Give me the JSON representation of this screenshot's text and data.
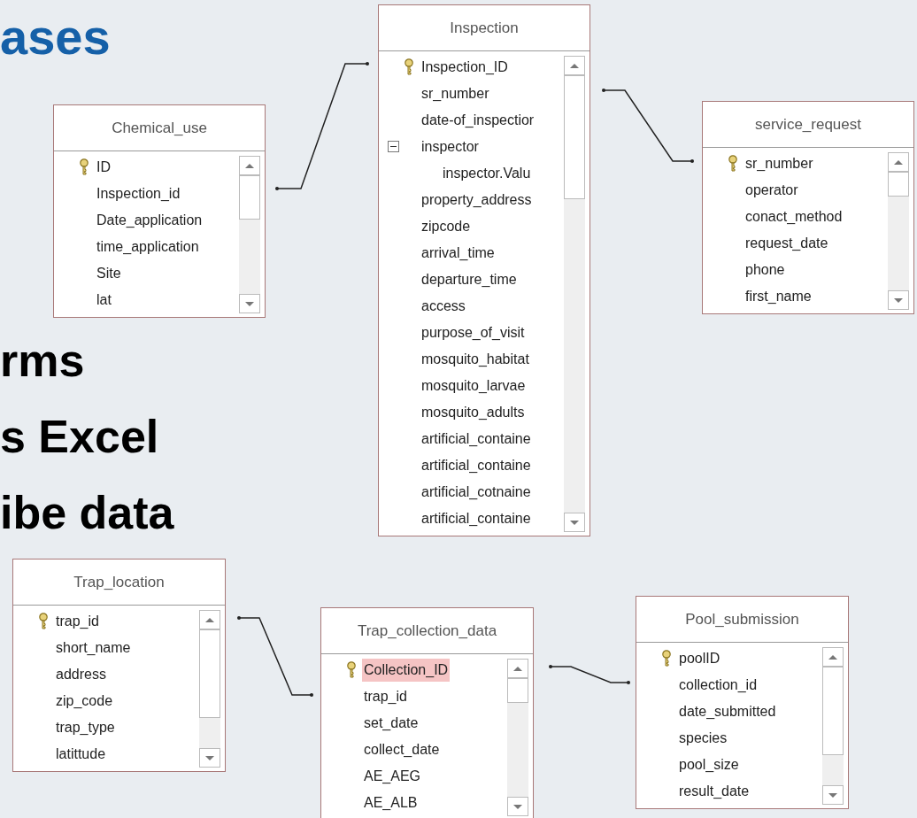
{
  "slide_text": [
    {
      "text": "ases",
      "kind": "heading"
    },
    {
      "text": "rms",
      "kind": "bullet"
    },
    {
      "text": "s Excel",
      "kind": "bullet"
    },
    {
      "text": "ibe data",
      "kind": "bullet"
    }
  ],
  "tables": [
    {
      "title": "Chemical_use",
      "fields": [
        {
          "name": "ID",
          "key": true,
          "selected": false
        },
        {
          "name": "Inspection_id",
          "key": false,
          "selected": false
        },
        {
          "name": "Date_application",
          "key": false,
          "selected": false
        },
        {
          "name": "time_application",
          "key": false,
          "selected": false
        },
        {
          "name": "Site",
          "key": false,
          "selected": false
        },
        {
          "name": "lat",
          "key": false,
          "selected": false
        }
      ]
    },
    {
      "title": "Inspection",
      "fields": [
        {
          "name": "Inspection_ID",
          "key": true,
          "selected": false
        },
        {
          "name": "sr_number",
          "key": false,
          "selected": false
        },
        {
          "name": "date-of_inspectior",
          "key": false,
          "selected": false
        },
        {
          "name": "inspector",
          "key": false,
          "selected": false,
          "expanded": true,
          "children": [
            {
              "name": "inspector.Valu",
              "key": false,
              "selected": false
            }
          ]
        },
        {
          "name": "property_address",
          "key": false,
          "selected": false
        },
        {
          "name": "zipcode",
          "key": false,
          "selected": false
        },
        {
          "name": "arrival_time",
          "key": false,
          "selected": false
        },
        {
          "name": "departure_time",
          "key": false,
          "selected": false
        },
        {
          "name": "access",
          "key": false,
          "selected": false
        },
        {
          "name": "purpose_of_visit",
          "key": false,
          "selected": false
        },
        {
          "name": "mosquito_habitat",
          "key": false,
          "selected": false
        },
        {
          "name": "mosquito_larvae",
          "key": false,
          "selected": false
        },
        {
          "name": "mosquito_adults",
          "key": false,
          "selected": false
        },
        {
          "name": "artificial_containe",
          "key": false,
          "selected": false
        },
        {
          "name": "artificial_containe",
          "key": false,
          "selected": false
        },
        {
          "name": "artificial_cotnaine",
          "key": false,
          "selected": false
        },
        {
          "name": "artificial_containe",
          "key": false,
          "selected": false
        }
      ]
    },
    {
      "title": "service_request",
      "fields": [
        {
          "name": "sr_number",
          "key": true,
          "selected": false
        },
        {
          "name": "operator",
          "key": false,
          "selected": false
        },
        {
          "name": "conact_method",
          "key": false,
          "selected": false
        },
        {
          "name": "request_date",
          "key": false,
          "selected": false
        },
        {
          "name": "phone",
          "key": false,
          "selected": false
        },
        {
          "name": "first_name",
          "key": false,
          "selected": false
        }
      ]
    },
    {
      "title": "Trap_location",
      "fields": [
        {
          "name": "trap_id",
          "key": true,
          "selected": false
        },
        {
          "name": "short_name",
          "key": false,
          "selected": false
        },
        {
          "name": "address",
          "key": false,
          "selected": false
        },
        {
          "name": "zip_code",
          "key": false,
          "selected": false
        },
        {
          "name": "trap_type",
          "key": false,
          "selected": false
        },
        {
          "name": "latittude",
          "key": false,
          "selected": false
        }
      ]
    },
    {
      "title": "Trap_collection_data",
      "fields": [
        {
          "name": "Collection_ID",
          "key": true,
          "selected": true
        },
        {
          "name": "trap_id",
          "key": false,
          "selected": false
        },
        {
          "name": "set_date",
          "key": false,
          "selected": false
        },
        {
          "name": "collect_date",
          "key": false,
          "selected": false
        },
        {
          "name": "AE_AEG",
          "key": false,
          "selected": false
        },
        {
          "name": "AE_ALB",
          "key": false,
          "selected": false
        }
      ]
    },
    {
      "title": "Pool_submission",
      "fields": [
        {
          "name": "poolID",
          "key": true,
          "selected": false
        },
        {
          "name": "collection_id",
          "key": false,
          "selected": false
        },
        {
          "name": "date_submitted",
          "key": false,
          "selected": false
        },
        {
          "name": "species",
          "key": false,
          "selected": false
        },
        {
          "name": "pool_size",
          "key": false,
          "selected": false
        },
        {
          "name": "result_date",
          "key": false,
          "selected": false
        }
      ]
    }
  ]
}
